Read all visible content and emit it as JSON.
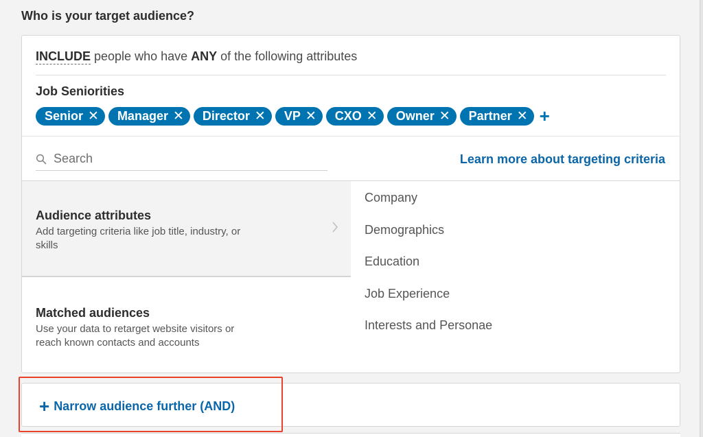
{
  "section": {
    "title": "Who is your target audience?"
  },
  "include": {
    "keyword": "INCLUDE",
    "middle": "people who have",
    "any_keyword": "ANY",
    "suffix": "of the following attributes"
  },
  "seniorities": {
    "label": "Job Seniorities",
    "pills": [
      "Senior",
      "Manager",
      "Director",
      "VP",
      "CXO",
      "Owner",
      "Partner"
    ],
    "remove_glyph": "✕",
    "add_glyph": "+"
  },
  "search": {
    "placeholder": "Search",
    "value": ""
  },
  "learn_more": "Learn more about targeting criteria",
  "attribute_groups": [
    {
      "title": "Audience attributes",
      "description": "Add targeting criteria like job title, industry, or skills"
    },
    {
      "title": "Matched audiences",
      "description": "Use your data to retarget website visitors or reach known contacts and accounts"
    }
  ],
  "categories": [
    "Company",
    "Demographics",
    "Education",
    "Job Experience",
    "Interests and Personae"
  ],
  "narrow": {
    "label": "Narrow audience further (AND)",
    "plus_glyph": "+"
  },
  "colors": {
    "accent": "#0073b1",
    "link": "#0a66a8",
    "highlight": "#e8412c"
  }
}
